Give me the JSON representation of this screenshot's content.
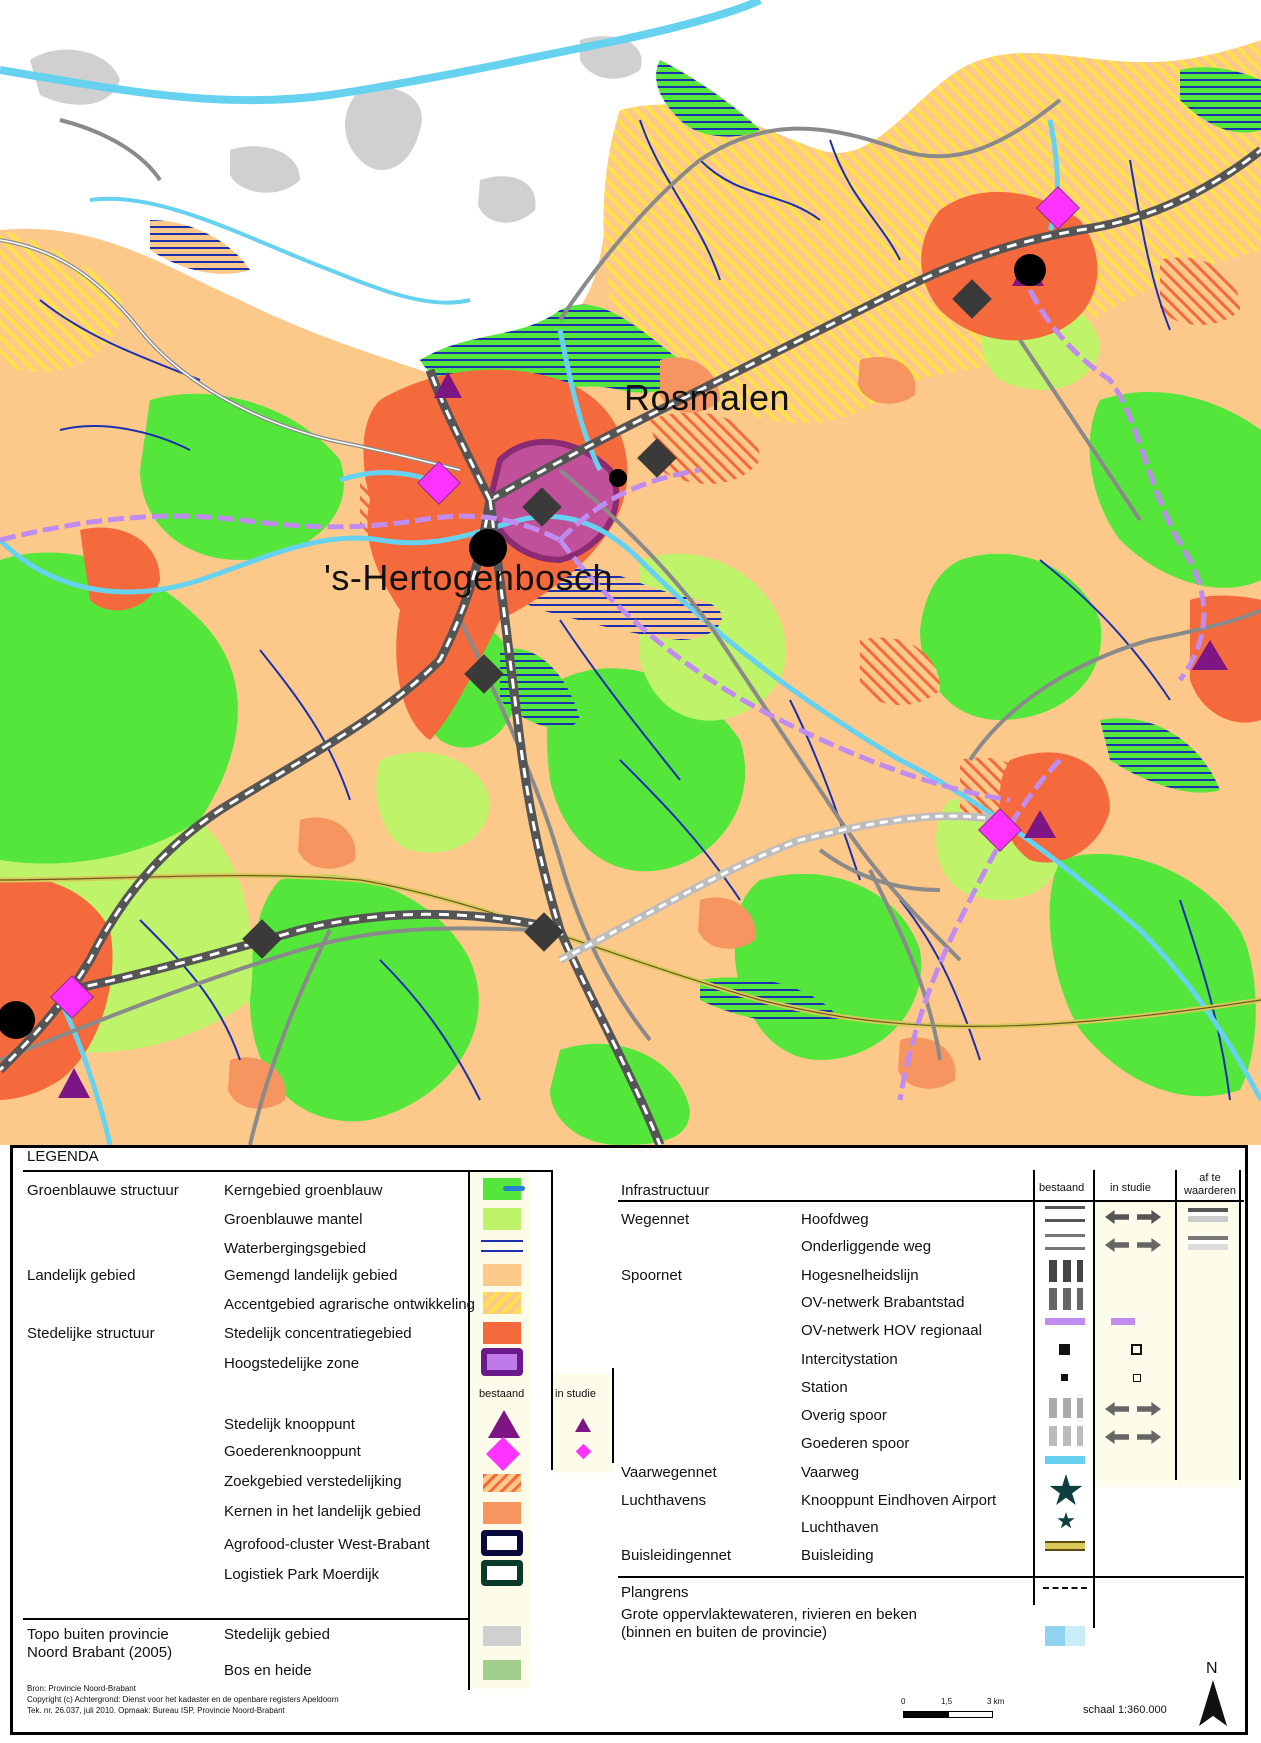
{
  "places": {
    "rosmalen": "Rosmalen",
    "shertogenbosch": "'s-Hertogenbosch"
  },
  "colors": {
    "green_core": "#55e63c",
    "green_mantle": "#bff46a",
    "rural_mixed": "#fdc98a",
    "agri_accent": "#fde24a",
    "urban_concentration": "#f56a3c",
    "high_urban": "#c0509a",
    "water": "#2f3fbf",
    "river": "#66d2f0",
    "topo_urban": "#d0d0d0",
    "topo_forest": "#a2cf8c",
    "node_purple": "#7e1585",
    "node_magenta": "#ff33ff",
    "ov_hov": "#c08cf0"
  },
  "legend": {
    "title": "LEGENDA",
    "left": {
      "groups": [
        {
          "group": "Groenblauwe structuur",
          "items": [
            "Kerngebied groenblauw",
            "Groenblauwe mantel",
            "Waterbergingsgebied"
          ]
        },
        {
          "group": "Landelijk gebied",
          "items": [
            "Gemengd landelijk gebied",
            "Accentgebied agrarische ontwikkeling"
          ]
        },
        {
          "group": "Stedelijke structuur",
          "items": [
            "Stedelijk concentratiegebied",
            "Hoogstedelijke zone"
          ]
        }
      ],
      "col_bestaand": "bestaand",
      "col_in_studie": "in studie",
      "nodes": [
        "Stedelijk knooppunt",
        "Goederenknooppunt"
      ],
      "more_items": [
        "Zoekgebied verstedelijking",
        "Kernen in het landelijk gebied",
        "Agrofood-cluster West-Brabant",
        "Logistiek Park Moerdijk"
      ],
      "topo_group": "Topo buiten provincie Noord Brabant (2005)",
      "topo_items": [
        "Stedelijk gebied",
        "Bos en heide"
      ]
    },
    "right": {
      "title": "Infrastructuur",
      "col_bestaand": "bestaand",
      "col_in_studie": "in studie",
      "col_af_te_waarderen": "af te waarderen",
      "rows": [
        {
          "group": "Wegennet",
          "item": "Hoofdweg"
        },
        {
          "group": "",
          "item": "Onderliggende weg"
        },
        {
          "group": "Spoornet",
          "item": "Hogesnelheidslijn"
        },
        {
          "group": "",
          "item": "OV-netwerk Brabantstad"
        },
        {
          "group": "",
          "item": "OV-netwerk HOV regionaal"
        },
        {
          "group": "",
          "item": "Intercitystation"
        },
        {
          "group": "",
          "item": "Station"
        },
        {
          "group": "",
          "item": "Overig spoor"
        },
        {
          "group": "",
          "item": "Goederen spoor"
        },
        {
          "group": "Vaarwegennet",
          "item": "Vaarweg"
        },
        {
          "group": "Luchthavens",
          "item": "Knooppunt Eindhoven Airport"
        },
        {
          "group": "",
          "item": "Luchthaven"
        },
        {
          "group": "Buisleidingennet",
          "item": "Buisleiding"
        }
      ],
      "plangrens": "Plangrens",
      "water_line1": "Grote oppervlaktewateren, rivieren en beken",
      "water_line2": "(binnen en buiten de provincie)"
    },
    "source": "Bron: Provincie Noord-Brabant",
    "copyright": "Copyright (c) Achtergrond: Dienst voor het kadaster en de openbare registers Apeldoorn",
    "tek": "Tek. nr. 26.037, juli 2010. Opmaak: Bureau ISP, Provincie Noord-Brabant",
    "scalebar_labels": [
      "0",
      "1,5",
      "3 km"
    ],
    "scale": "schaal 1:360.000",
    "north": "N"
  }
}
